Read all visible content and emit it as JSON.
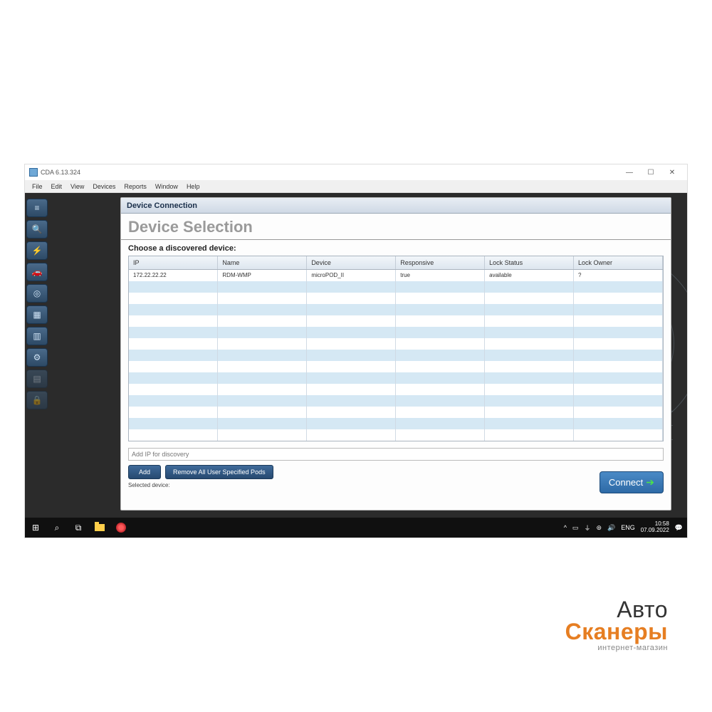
{
  "window": {
    "title": "CDA 6.13.324",
    "min_icon": "—",
    "max_icon": "☐",
    "close_icon": "✕"
  },
  "menu": [
    "File",
    "Edit",
    "View",
    "Devices",
    "Reports",
    "Window",
    "Help"
  ],
  "panel": {
    "header": "Device Connection",
    "title": "Device Selection",
    "subtitle": "Choose a discovered device:"
  },
  "table": {
    "columns": [
      "IP",
      "Name",
      "Device",
      "Responsive",
      "Lock Status",
      "Lock Owner"
    ],
    "rows": [
      {
        "ip": "172.22.22.22",
        "name": "RDM-WMP",
        "device": "microPOD_II",
        "responsive": "true",
        "lock_status": "available",
        "lock_owner": "?"
      }
    ]
  },
  "ip_input": {
    "placeholder": "Add IP for discovery"
  },
  "buttons": {
    "add": "Add",
    "remove": "Remove All User Specified Pods",
    "connect": "Connect"
  },
  "selected_label": "Selected device:",
  "taskbar": {
    "lang": "ENG",
    "time": "10:58",
    "date": "07.09.2022"
  },
  "watermark": {
    "line1": "Авто",
    "line2": "Сканеры",
    "line3": "интернет-магазин"
  }
}
